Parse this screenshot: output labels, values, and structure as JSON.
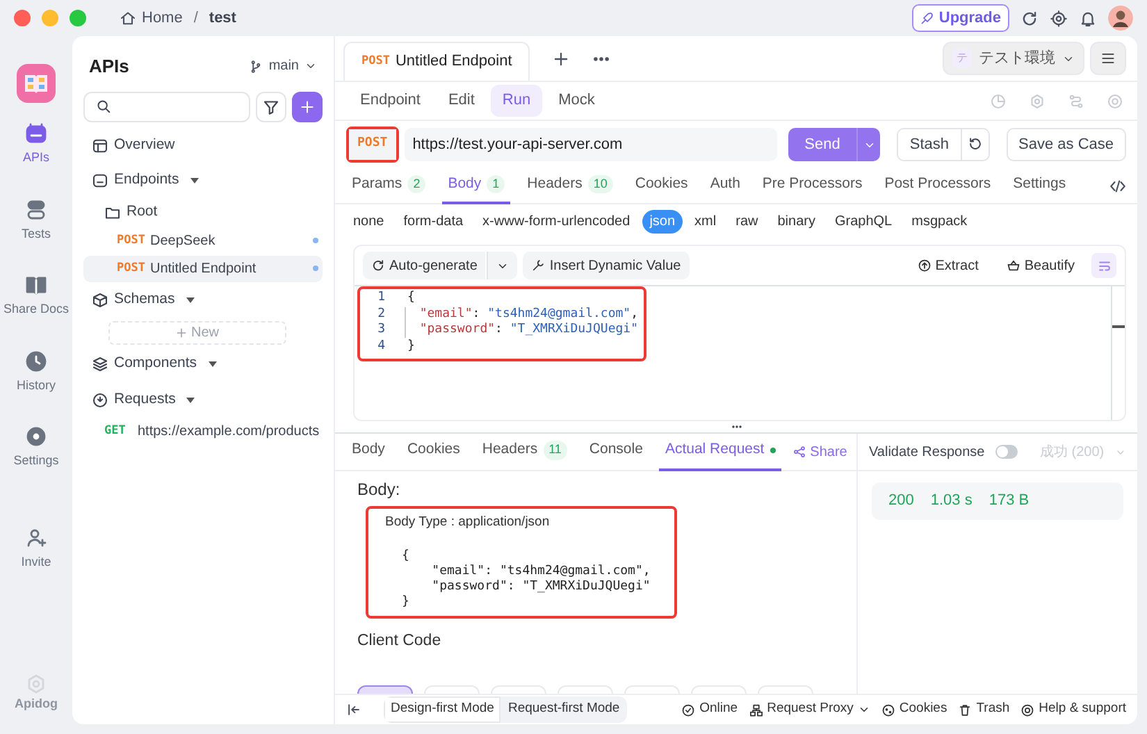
{
  "titlebar": {
    "breadcrumb": [
      {
        "label": "Home"
      },
      {
        "label": "test"
      }
    ],
    "separator": "/",
    "upgrade": "Upgrade"
  },
  "rail": {
    "items": [
      {
        "label": "APIs",
        "selected": true
      },
      {
        "label": "Tests",
        "selected": false
      },
      {
        "label": "Share Docs",
        "selected": false
      },
      {
        "label": "History",
        "selected": false
      },
      {
        "label": "Settings",
        "selected": false
      },
      {
        "label": "Invite",
        "selected": false
      }
    ],
    "brand": "Apidog"
  },
  "sidebar": {
    "title": "APIs",
    "branch": "main",
    "tree": [
      {
        "kind": "section",
        "label": "Overview"
      },
      {
        "kind": "group",
        "label": "Endpoints",
        "expanded": true,
        "children": [
          {
            "kind": "folder",
            "label": "Root",
            "children": [
              {
                "kind": "endpoint",
                "method": "POST",
                "color": "#f07a2a",
                "label": "DeepSeek",
                "selected": false,
                "dot": true
              },
              {
                "kind": "endpoint",
                "method": "POST",
                "color": "#f07a2a",
                "label": "Untitled Endpoint",
                "selected": true,
                "dot": true
              }
            ]
          }
        ]
      },
      {
        "kind": "group",
        "label": "Schemas",
        "expanded": true,
        "children": [
          {
            "kind": "new",
            "label": "New"
          }
        ]
      },
      {
        "kind": "group",
        "label": "Components",
        "expanded": true
      },
      {
        "kind": "group",
        "label": "Requests",
        "expanded": true,
        "children": [
          {
            "kind": "endpoint",
            "method": "GET",
            "color": "#22b35e",
            "label": "https://example.com/products",
            "selected": false,
            "dot": false
          }
        ]
      }
    ]
  },
  "tabs": [
    {
      "method": "POST",
      "label": "Untitled Endpoint",
      "selected": true
    }
  ],
  "environment": {
    "badge": "テ",
    "label": "テスト環境"
  },
  "modes": [
    {
      "label": "Endpoint",
      "selected": false
    },
    {
      "label": "Edit",
      "selected": false
    },
    {
      "label": "Run",
      "selected": true
    },
    {
      "label": "Mock",
      "selected": false
    }
  ],
  "request": {
    "method": "POST",
    "url": "https://test.your-api-server.com",
    "send": "Send",
    "stash": "Stash",
    "save": "Save as Case"
  },
  "request_tabs": [
    {
      "label": "Params",
      "count": "2",
      "selected": false
    },
    {
      "label": "Body",
      "count": "1",
      "selected": true
    },
    {
      "label": "Headers",
      "count": "10",
      "selected": false
    },
    {
      "label": "Cookies",
      "selected": false
    },
    {
      "label": "Auth",
      "selected": false
    },
    {
      "label": "Pre Processors",
      "selected": false
    },
    {
      "label": "Post Processors",
      "selected": false
    },
    {
      "label": "Settings",
      "selected": false
    }
  ],
  "body_types": [
    {
      "label": "none",
      "selected": false
    },
    {
      "label": "form-data",
      "selected": false
    },
    {
      "label": "x-www-form-urlencoded",
      "selected": false
    },
    {
      "label": "json",
      "selected": true
    },
    {
      "label": "xml",
      "selected": false
    },
    {
      "label": "raw",
      "selected": false
    },
    {
      "label": "binary",
      "selected": false
    },
    {
      "label": "GraphQL",
      "selected": false
    },
    {
      "label": "msgpack",
      "selected": false
    }
  ],
  "editor": {
    "auto_generate": "Auto-generate",
    "insert": "Insert Dynamic Value",
    "extract": "Extract",
    "beautify": "Beautify",
    "lines": [
      {
        "number": "1",
        "indent": false,
        "tokens": [
          {
            "kind": "punct",
            "text": "{"
          }
        ]
      },
      {
        "number": "2",
        "indent": true,
        "tokens": [
          {
            "kind": "key",
            "text": "\"email\""
          },
          {
            "kind": "punct",
            "text": ": "
          },
          {
            "kind": "string",
            "text": "\"ts4hm24@gmail.com\""
          },
          {
            "kind": "punct",
            "text": ","
          }
        ]
      },
      {
        "number": "3",
        "indent": true,
        "tokens": [
          {
            "kind": "key",
            "text": "\"password\""
          },
          {
            "kind": "punct",
            "text": ": "
          },
          {
            "kind": "string",
            "text": "\"T_XMRXiDuJQUegi\""
          }
        ]
      },
      {
        "number": "4",
        "indent": false,
        "tokens": [
          {
            "kind": "punct",
            "text": "}"
          }
        ]
      }
    ]
  },
  "response": {
    "tabs": [
      {
        "label": "Body",
        "selected": false,
        "dot": false
      },
      {
        "label": "Cookies",
        "selected": false,
        "dot": false
      },
      {
        "label": "Headers",
        "count": "11",
        "selected": false,
        "dot": false
      },
      {
        "label": "Console",
        "selected": false,
        "dot": false
      },
      {
        "label": "Actual Request",
        "selected": true,
        "dot": true
      }
    ],
    "share": "Share",
    "section_title": "Body:",
    "body_type": "Body Type : application/json",
    "body_lines": [
      "{",
      "    \"email\": \"ts4hm24@gmail.com\",",
      "    \"password\": \"T_XMRXiDuJQUegi\"",
      "}"
    ],
    "client_code": "Client Code",
    "client_code_tabs": [
      {
        "selected": true
      },
      {
        "selected": false
      },
      {
        "selected": false
      },
      {
        "selected": false
      },
      {
        "selected": false
      },
      {
        "selected": false
      },
      {
        "selected": false
      }
    ],
    "validate": {
      "label": "Validate Response",
      "on": false
    },
    "status_select": "成功 (200)",
    "status": {
      "code": "200",
      "time": "1.03 s",
      "size": "173 B"
    }
  },
  "bottom_bar": {
    "modes": [
      {
        "label": "Design-first Mode",
        "selected": true
      },
      {
        "label": "Request-first Mode",
        "selected": false
      }
    ],
    "items": [
      "Online",
      "Request Proxy",
      "Cookies",
      "Trash",
      "Help & support"
    ]
  }
}
